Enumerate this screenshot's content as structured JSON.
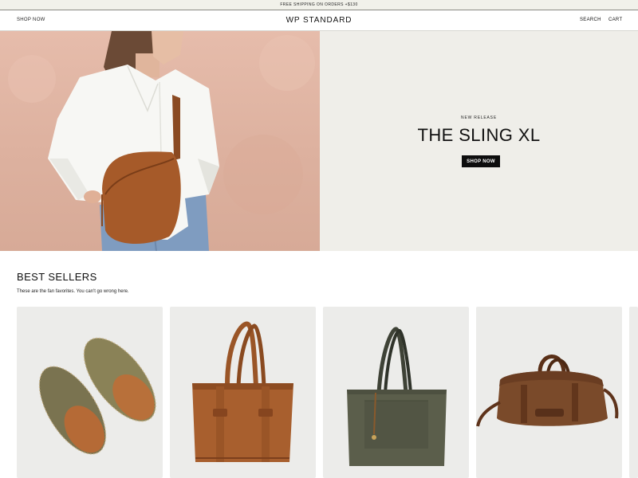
{
  "announcement": {
    "text": "FREE SHIPPING ON ORDERS +$130"
  },
  "header": {
    "nav_left": "SHOP NOW",
    "logo": "WP STANDARD",
    "search": "SEARCH",
    "cart": "CART"
  },
  "hero": {
    "kicker": "NEW RELEASE",
    "title": "THE SLING XL",
    "button": "SHOP NOW",
    "image_icon": "model-with-sling-bag"
  },
  "best_sellers": {
    "title": "BEST SELLERS",
    "subtitle": "These are the fan favorites. You can't go wrong here.",
    "products": [
      {
        "image_icon": "suede-slippers"
      },
      {
        "image_icon": "brown-leather-tote"
      },
      {
        "image_icon": "olive-canvas-tote"
      },
      {
        "image_icon": "leather-duffle-bag"
      },
      {
        "image_icon": "partial-product-card"
      }
    ]
  },
  "colors": {
    "announcement_bg": "#f1f1ea",
    "hero_panel_bg": "#efeee9",
    "card_bg": "#ececea",
    "button_bg": "#0d0d0d",
    "leather_brown": "#9a5527"
  }
}
